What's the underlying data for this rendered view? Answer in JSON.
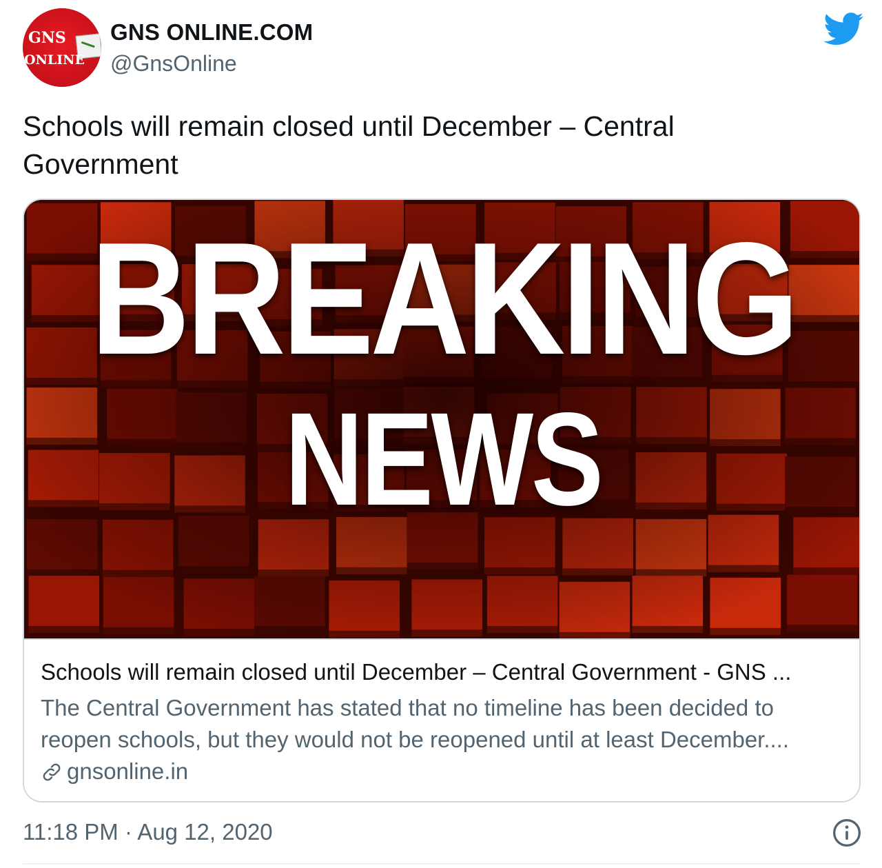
{
  "author": {
    "display_name": "GNS ONLINE.COM",
    "handle": "@GnsOnline",
    "avatar": {
      "icon": "gns-online-logo",
      "text_top": "GNS",
      "text_bottom": "ONLINE"
    }
  },
  "brand_icon": "twitter-bird-icon",
  "tweet": {
    "text": "Schools will remain closed until December – Central Government"
  },
  "card": {
    "image": {
      "line1": "BREAKING",
      "line2": "NEWS"
    },
    "title": "Schools will remain closed until December – Central Government - GNS ...",
    "description": "The Central Government has stated that no timeline has been decided to reopen schools, but they would not be reopened until at least December....",
    "domain": "gnsonline.in",
    "domain_icon": "link-icon"
  },
  "timestamp": "11:18 PM · Aug 12, 2020",
  "info_icon": "info-icon",
  "colors": {
    "twitter_blue": "#1d9bf0",
    "secondary_text": "#536471",
    "border": "#cfd9de",
    "avatar_red": "#d3141b"
  }
}
